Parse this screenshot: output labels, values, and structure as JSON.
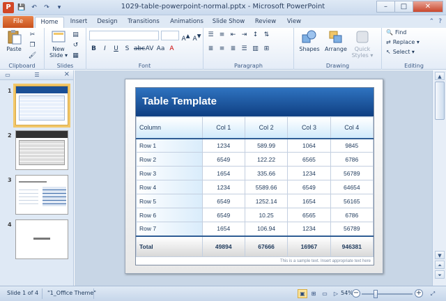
{
  "window": {
    "title": "1029-table-powerpoint-normal.pptx - Microsoft PowerPoint",
    "app_icon_letter": "P",
    "controls": {
      "minimize": "–",
      "maximize": "□",
      "close": "✕"
    }
  },
  "tabs": {
    "file": "File",
    "items": [
      {
        "label": "Home",
        "active": true
      },
      {
        "label": "Insert",
        "active": false
      },
      {
        "label": "Design",
        "active": false
      },
      {
        "label": "Transitions",
        "active": false
      },
      {
        "label": "Animations",
        "active": false
      },
      {
        "label": "Slide Show",
        "active": false
      },
      {
        "label": "Review",
        "active": false
      },
      {
        "label": "View",
        "active": false
      }
    ]
  },
  "ribbon": {
    "clipboard": {
      "label": "Clipboard",
      "paste": "Paste"
    },
    "slides": {
      "label": "Slides",
      "new_slide": "New",
      "new_slide_2": "Slide ▾"
    },
    "font": {
      "label": "Font"
    },
    "paragraph": {
      "label": "Paragraph"
    },
    "drawing": {
      "label": "Drawing",
      "shapes": "Shapes",
      "arrange": "Arrange",
      "quick_styles": "Quick",
      "quick_styles_2": "Styles ▾"
    },
    "editing": {
      "label": "Editing",
      "find": "Find",
      "replace": "Replace ▾",
      "select": "Select ▾"
    }
  },
  "thumbnails": [
    {
      "number": "1",
      "selected": true
    },
    {
      "number": "2",
      "selected": false
    },
    {
      "number": "3",
      "selected": false
    },
    {
      "number": "4",
      "selected": false
    }
  ],
  "slide": {
    "title": "Table Template",
    "header": [
      "Column",
      "Col 1",
      "Col 2",
      "Col 3",
      "Col 4"
    ],
    "rows": [
      [
        "Row 1",
        "1234",
        "589.99",
        "1064",
        "9845"
      ],
      [
        "Row 2",
        "6549",
        "122.22",
        "6565",
        "6786"
      ],
      [
        "Row 3",
        "1654",
        "335.66",
        "1234",
        "56789"
      ],
      [
        "Row 4",
        "1234",
        "5589.66",
        "6549",
        "64654"
      ],
      [
        "Row 5",
        "6549",
        "1252.14",
        "1654",
        "56165"
      ],
      [
        "Row 6",
        "6549",
        "10.25",
        "6565",
        "6786"
      ],
      [
        "Row 7",
        "1654",
        "106.94",
        "1234",
        "56789"
      ]
    ],
    "total": [
      "Total",
      "49894",
      "67666",
      "16967",
      "946381"
    ],
    "note": "This is a sample text. Insert appropriate text here"
  },
  "status": {
    "slide_info": "Slide 1 of 4",
    "theme": "\"1_Office Theme\"",
    "zoom": "54%",
    "zoom_minus": "−",
    "zoom_plus": "+"
  }
}
